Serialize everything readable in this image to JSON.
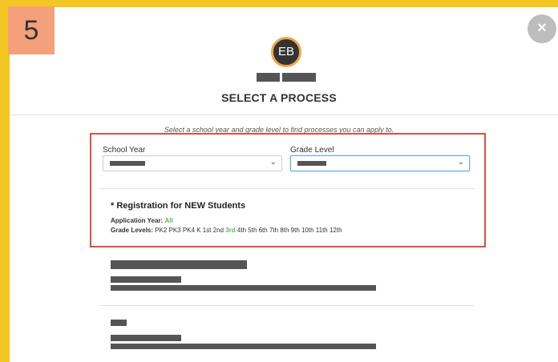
{
  "step_number": "5",
  "close_glyph": "×",
  "avatar_initials": "EB",
  "title": "SELECT A PROCESS",
  "hint": "Select a school year and grade level to find processes you can apply to.",
  "filters": {
    "school_year_label": "School Year",
    "grade_level_label": "Grade Level"
  },
  "process": {
    "title": "* Registration for NEW Students",
    "app_year_label": "Application Year:",
    "app_year_value": "All",
    "grade_levels_label": "Grade Levels:",
    "grades_before": "PK2 PK3 PK4 K 1st 2nd",
    "grade_highlight": "3rd",
    "grades_after": "4th 5th 6th 7th 8th 9th 10th 11th 12th"
  },
  "icons": {
    "chevron": "chevron-down-icon",
    "close": "close-icon"
  },
  "colors": {
    "frame": "#f3c623",
    "step_badge": "#f4a07a",
    "panel_border": "#d9533b",
    "highlight_green": "#5cb85c",
    "avatar_ring": "#f0a64a"
  }
}
